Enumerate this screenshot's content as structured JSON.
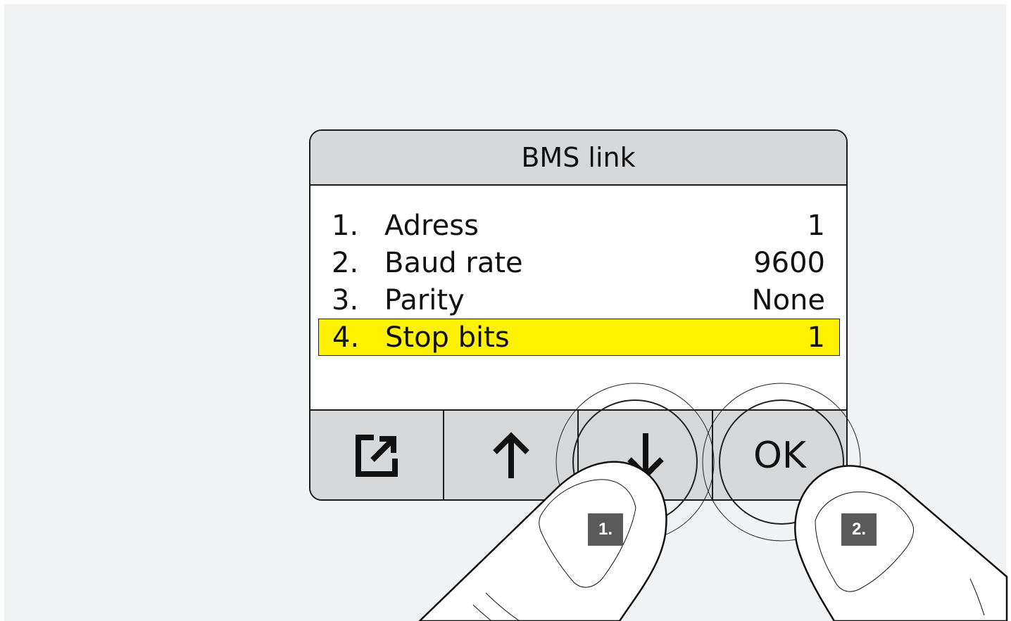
{
  "screen": {
    "title": "BMS link",
    "menu_items": [
      {
        "num": "1.",
        "label": "Adress",
        "value": "1"
      },
      {
        "num": "2.",
        "label": "Baud rate",
        "value": "9600"
      },
      {
        "num": "3.",
        "label": "Parity",
        "value": "None"
      },
      {
        "num": "4.",
        "label": "Stop bits",
        "value": "1"
      }
    ],
    "selected_index": 3,
    "highlight_color": "#fff200"
  },
  "softkeys": [
    {
      "icon": "export-icon"
    },
    {
      "icon": "arrow-up-icon"
    },
    {
      "icon": "arrow-down-icon"
    },
    {
      "label": "OK"
    }
  ],
  "steps": [
    {
      "label": "1."
    },
    {
      "label": "2."
    }
  ]
}
